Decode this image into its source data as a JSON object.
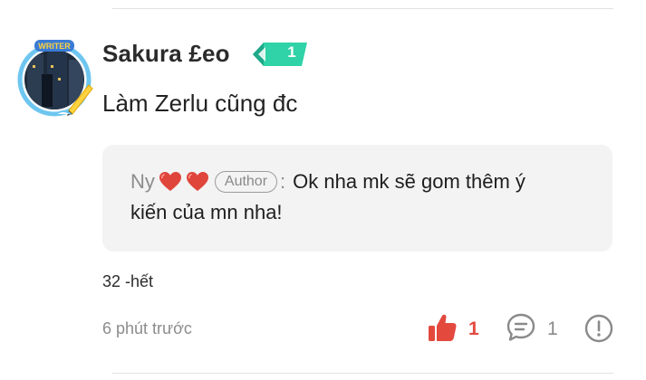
{
  "comment": {
    "username": "Sakura £eo",
    "level": "1",
    "avatar_badge_text": "WRITER",
    "text": "Làm Zerlu cũng đc"
  },
  "reply": {
    "author_name": "Ny",
    "author_tag": "Author",
    "separator": ":",
    "text_line1": "Ok nha mk sẽ gom thêm ý",
    "text_line2": "kiến của mn nha!"
  },
  "extra_note": "32 -hết",
  "footer": {
    "timestamp": "6 phút trước",
    "like_count": "1",
    "comment_count": "1"
  },
  "colors": {
    "like": "#e4493e",
    "badge": "#2fd3a7",
    "muted": "#8c8c8c",
    "reply_bg": "#f3f3f3"
  },
  "icons": {
    "like": "thumbs-up-icon",
    "comment": "speech-bubble-icon",
    "report": "exclamation-circle-icon",
    "heart": "heart-icon"
  }
}
